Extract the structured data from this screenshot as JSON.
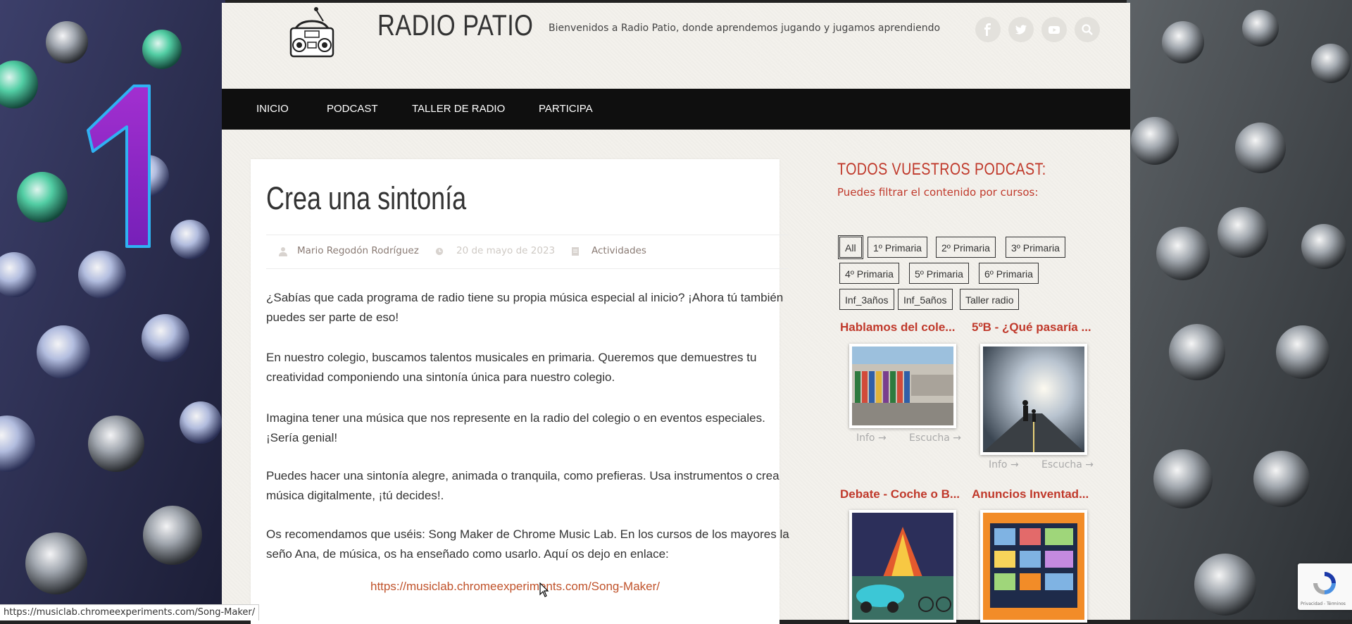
{
  "site": {
    "title": "RADIO PATIO",
    "tagline": "Bienvenidos a Radio Patio, donde aprendemos jugando y jugamos aprendiendo"
  },
  "social_icons": [
    "facebook-icon",
    "twitter-icon",
    "youtube-icon",
    "search-icon"
  ],
  "nav": {
    "items": [
      {
        "label": "INICIO"
      },
      {
        "label": "PODCAST"
      },
      {
        "label": "TALLER DE RADIO"
      },
      {
        "label": "PARTICIPA"
      }
    ]
  },
  "background": {
    "number_graphic": "1"
  },
  "article": {
    "title": "Crea una sintonía",
    "author": "Mario Regodón Rodríguez",
    "date": "20 de mayo de 2023",
    "category": "Actividades",
    "paragraphs": [
      "¿Sabías que cada programa de radio tiene su propia música especial al inicio? ¡Ahora tú también puedes ser parte de eso!",
      "En nuestro colegio, buscamos talentos musicales en primaria. Queremos que demuestres tu creatividad componiendo una sintonía única para nuestro colegio.",
      "Imagina tener una música que nos represente en la radio del colegio o en eventos especiales. ¡Sería genial!",
      "Puedes hacer una sintonía alegre, animada o tranquila, como prefieras. Usa instrumentos o crea música digitalmente, ¡tú decides!.",
      "Os recomendamos que uséis: Song Maker de Chrome Music Lab. En los cursos de los mayores la seño Ana, de música, os ha enseñado como usarlo. Aquí os dejo en enlace:"
    ],
    "link": "https://musiclab.chromeexperiments.com/Song-Maker/"
  },
  "sidebar": {
    "title": "TODOS VUESTROS PODCAST:",
    "subtitle": "Puedes filtrar el contenido por cursos:",
    "filters": [
      "All",
      "1º Primaria",
      "2º Primaria",
      "3º Primaria",
      "4º Primaria",
      "5º Primaria",
      "6º Primaria",
      "Inf_3años",
      "Inf_5años",
      "Taller radio"
    ],
    "active_filter": "All",
    "cards": [
      {
        "title": "Hablamos del cole...",
        "info": "Info →",
        "listen": "Escucha →"
      },
      {
        "title": "5ºB - ¿Qué pasaría ...",
        "info": "Info →",
        "listen": "Escucha →"
      },
      {
        "title": "Debate - Coche o B..."
      },
      {
        "title": "Anuncios Inventad..."
      }
    ]
  },
  "statusbar": {
    "url": "https://musiclab.chromeexperiments.com/Song-Maker/"
  },
  "recaptcha": {
    "terms": "Privacidad - Términos"
  },
  "colors": {
    "accent": "#c0392b",
    "nav_bg": "#0f0f0f",
    "link": "#c0532b"
  }
}
